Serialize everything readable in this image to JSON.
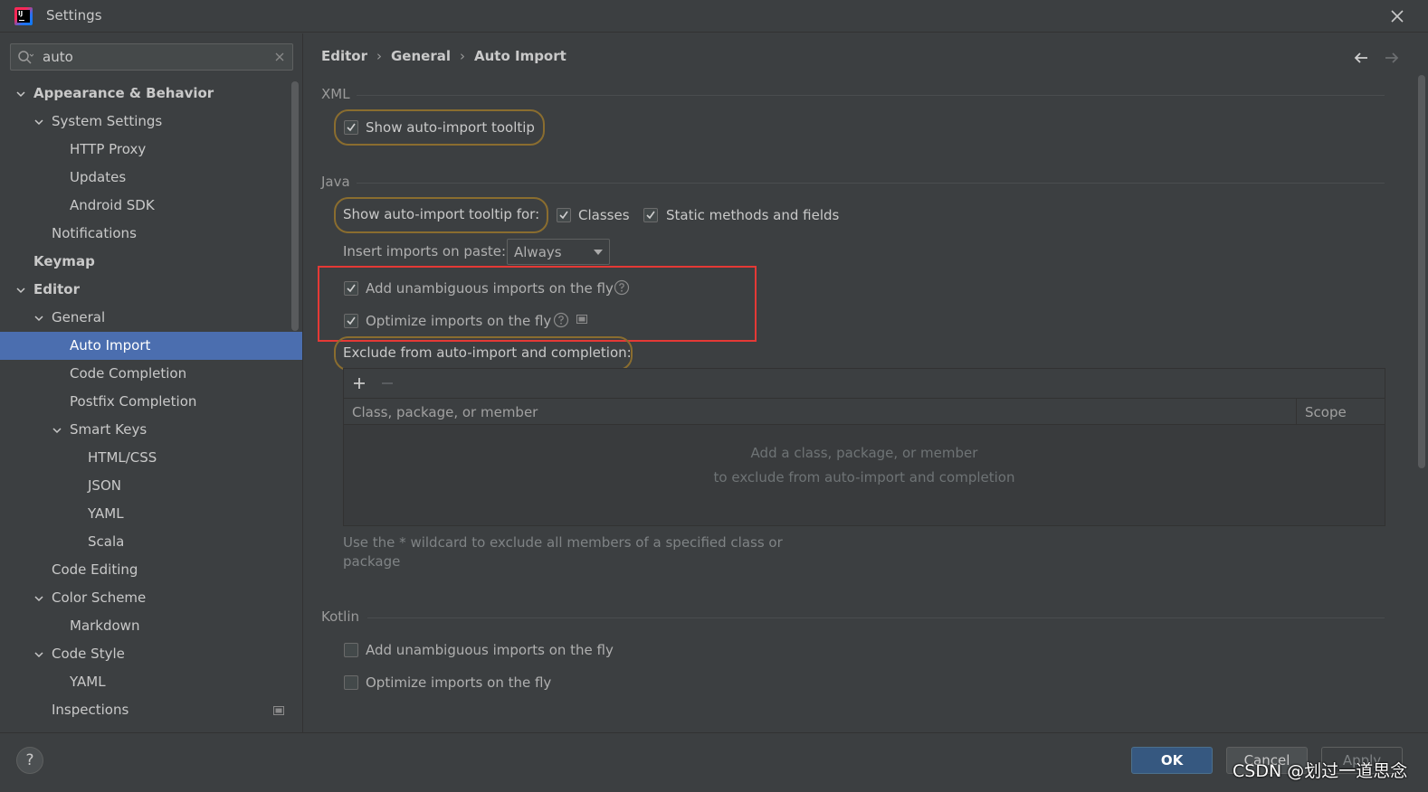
{
  "window": {
    "title": "Settings"
  },
  "search": {
    "value": "auto"
  },
  "sidebar": {
    "items": [
      {
        "label": "Appearance & Behavior",
        "level": 0,
        "expanded": true,
        "bold": true
      },
      {
        "label": "System Settings",
        "level": 1,
        "expanded": true
      },
      {
        "label": "HTTP Proxy",
        "level": 2
      },
      {
        "label": "Updates",
        "level": 2
      },
      {
        "label": "Android SDK",
        "level": 2
      },
      {
        "label": "Notifications",
        "level": 1
      },
      {
        "label": "Keymap",
        "level": 0,
        "bold": true
      },
      {
        "label": "Editor",
        "level": 0,
        "expanded": true,
        "bold": true
      },
      {
        "label": "General",
        "level": 1,
        "expanded": true
      },
      {
        "label": "Auto Import",
        "level": 2,
        "selected": true
      },
      {
        "label": "Code Completion",
        "level": 2
      },
      {
        "label": "Postfix Completion",
        "level": 2
      },
      {
        "label": "Smart Keys",
        "level": 2,
        "expanded": true
      },
      {
        "label": "HTML/CSS",
        "level": 3
      },
      {
        "label": "JSON",
        "level": 3
      },
      {
        "label": "YAML",
        "level": 3
      },
      {
        "label": "Scala",
        "level": 3
      },
      {
        "label": "Code Editing",
        "level": 1
      },
      {
        "label": "Color Scheme",
        "level": 1,
        "expanded": true
      },
      {
        "label": "Markdown",
        "level": 2
      },
      {
        "label": "Code Style",
        "level": 1,
        "expanded": true
      },
      {
        "label": "YAML",
        "level": 2
      },
      {
        "label": "Inspections",
        "level": 1,
        "badge": true
      }
    ]
  },
  "breadcrumb": {
    "part1": "Editor",
    "part2": "General",
    "part3": "Auto Import",
    "separator": "›"
  },
  "xml": {
    "title": "XML",
    "show_tooltip": {
      "label": "Show auto-import tooltip",
      "checked": true
    }
  },
  "java": {
    "title": "Java",
    "tooltip_for_label": "Show auto-import tooltip for:",
    "classes": {
      "label": "Classes",
      "checked": true
    },
    "static_methods": {
      "label": "Static methods and fields",
      "checked": true
    },
    "insert_on_paste_label": "Insert imports on paste:",
    "insert_on_paste_value": "Always",
    "add_unambiguous": {
      "label": "Add unambiguous imports on the fly",
      "checked": true
    },
    "optimize_imports": {
      "label": "Optimize imports on the fly",
      "checked": true
    },
    "exclude_label": "Exclude from auto-import and completion:",
    "table": {
      "columns": [
        "Class, package, or member",
        "Scope"
      ],
      "empty_line1": "Add a class, package, or member",
      "empty_line2": "to exclude from auto-import and completion"
    },
    "hint_line1": "Use the * wildcard to exclude all members of a specified class or",
    "hint_line2": "package"
  },
  "kotlin": {
    "title": "Kotlin",
    "add_unambiguous": {
      "label": "Add unambiguous imports on the fly",
      "checked": false
    },
    "optimize_imports": {
      "label": "Optimize imports on the fly",
      "checked": false
    }
  },
  "footer": {
    "help": "?",
    "ok": "OK",
    "cancel": "Cancel",
    "apply": "Apply",
    "watermark": "CSDN @划过一道思念"
  },
  "colors": {
    "background": "#3c3f41",
    "selection": "#4b6eaf",
    "ok_button": "#365880",
    "highlight_pill": "#8a6d2f",
    "highlight_box": "#e53935"
  }
}
